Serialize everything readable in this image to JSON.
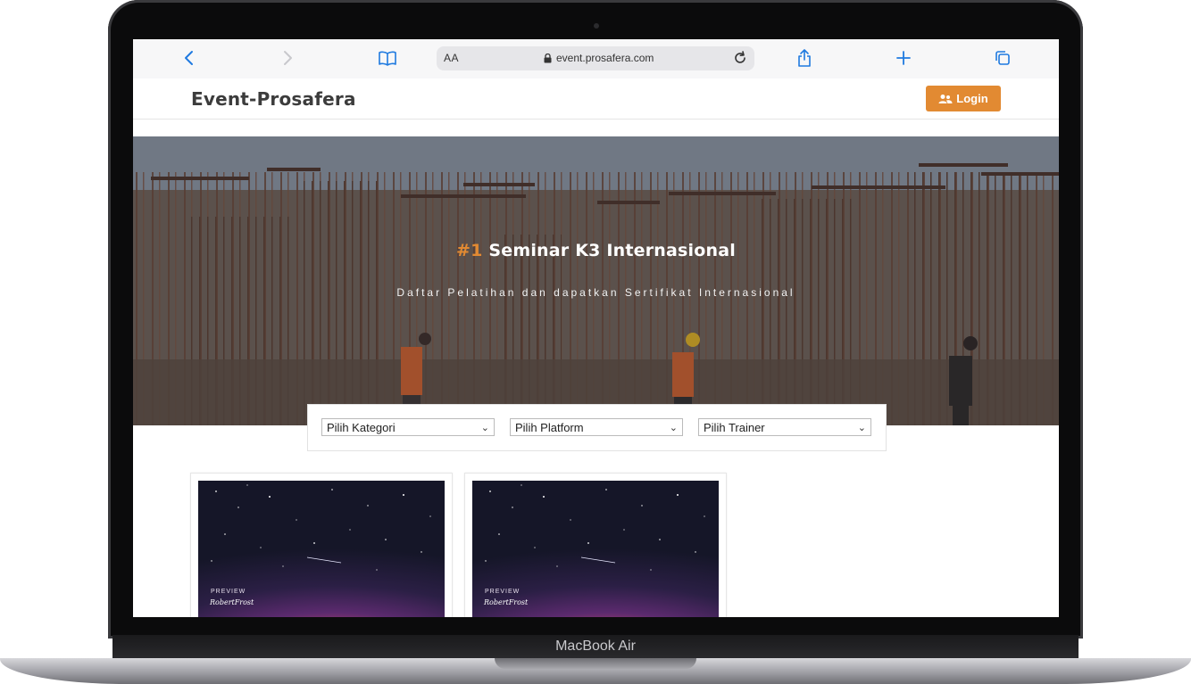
{
  "device": {
    "label": "MacBook Air"
  },
  "browser": {
    "address_prefix": "AA",
    "url": "event.prosafera.com",
    "icons": [
      "back-icon",
      "forward-icon",
      "bookmarks-icon",
      "lock-icon",
      "reload-icon",
      "share-icon",
      "new-tab-icon",
      "tabs-icon"
    ]
  },
  "site": {
    "logo": "Event-Prosafera",
    "login_label": "Login",
    "accent_color": "#e28a32"
  },
  "hero": {
    "title_accent": "#1",
    "title_rest": " Seminar K3 Internasional",
    "subtitle": "Daftar Pelatihan dan dapatkan Sertifikat Internasional"
  },
  "filters": {
    "category": "Pilih Kategori",
    "platform": "Pilih Platform",
    "trainer": "Pilih Trainer"
  },
  "cards": [
    {
      "preview_label": "PREVIEW",
      "signature": "RobertFrost"
    },
    {
      "preview_label": "PREVIEW",
      "signature": "RobertFrost"
    }
  ]
}
